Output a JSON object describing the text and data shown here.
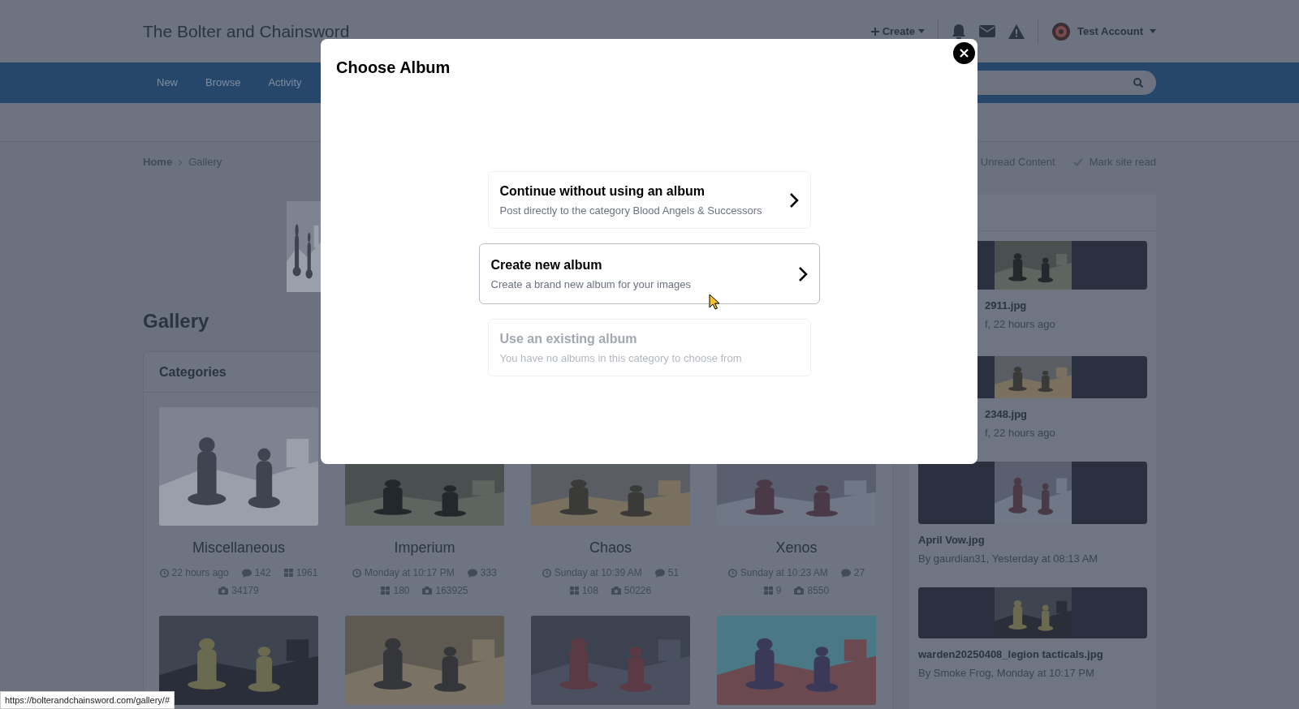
{
  "header": {
    "site_title": "The Bolter and Chainsword",
    "create_label": "Create",
    "account_name": "Test Account"
  },
  "nav": {
    "items": [
      {
        "label": "New"
      },
      {
        "label": "Browse"
      },
      {
        "label": "Activity"
      }
    ]
  },
  "breadcrumb": [
    "Home",
    "Gallery"
  ],
  "page_actions": [
    "Unread Content",
    "Mark site read"
  ],
  "page_title": "Gallery",
  "categories": {
    "title": "Categories",
    "items": [
      {
        "kind": "category",
        "name": "Miscellaneous",
        "last_activity": "22 hours ago",
        "comments": "142",
        "albums": "1961",
        "images": "34179"
      },
      {
        "kind": "category",
        "name": "Imperium",
        "last_activity": "Monday at 10:17 PM",
        "comments": "333",
        "albums": "180",
        "images": "163925"
      },
      {
        "kind": "category",
        "name": "Chaos",
        "last_activity": "Sunday at 10:39 AM",
        "comments": "51",
        "albums": "108",
        "images": "50226"
      },
      {
        "kind": "category",
        "name": "Xenos",
        "last_activity": "Sunday at 10:23 AM",
        "comments": "27",
        "albums": "9",
        "images": "8550"
      },
      {
        "kind": "picture"
      },
      {
        "kind": "picture"
      },
      {
        "kind": "picture"
      },
      {
        "kind": "picture"
      }
    ]
  },
  "sidebar": {
    "items": [
      {
        "kind": "partly_covered",
        "title": "2911.jpg",
        "meta": "f, 22 hours ago"
      },
      {
        "kind": "partly_covered",
        "title": "2348.jpg",
        "meta": "f, 22 hours ago"
      },
      {
        "kind": "full",
        "title": "April Vow.jpg",
        "meta": "By gaurdian31, Yesterday at 08:13 AM"
      },
      {
        "kind": "full",
        "title": "warden20250408_legion tacticals.jpg",
        "meta": "By Smoke Frog, Monday at 10:17 PM"
      }
    ]
  },
  "modal": {
    "title": "Choose Album",
    "options": [
      {
        "title": "Continue without using an album",
        "description": "Post directly to the category Blood Angels & Successors",
        "hovered": false,
        "disabled": false
      },
      {
        "title": "Create new album",
        "description": "Create a brand new album for your images",
        "hovered": true,
        "disabled": false
      },
      {
        "title": "Use an existing album",
        "description": "You have no albums in this category to choose from",
        "hovered": false,
        "disabled": true
      }
    ]
  },
  "status_bar": {
    "url": "https://bolterandchainsword.com/gallery/#"
  }
}
